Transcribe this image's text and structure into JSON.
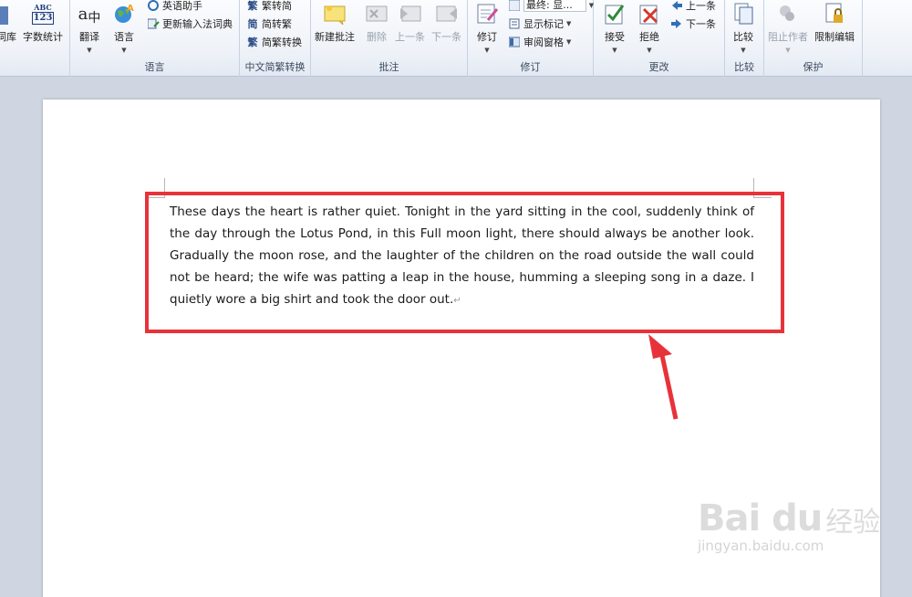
{
  "ribbon": {
    "groups": {
      "proofing_partial": {
        "label": ""
      },
      "language": {
        "label": "语言",
        "translate": "翻译",
        "language": "语言",
        "english_assistant": "英语助手",
        "update_ime_dict": "更新输入法词典"
      },
      "chinese_conversion": {
        "label": "中文简繁转换",
        "trad_to_simp": "繁转简",
        "simp_to_trad": "简转繁",
        "conversion": "简繁转换"
      },
      "comments": {
        "label": "批注",
        "new_comment": "新建批注",
        "delete": "删除",
        "previous": "上一条",
        "next": "下一条"
      },
      "tracking": {
        "label": "修订",
        "track_changes": "修订",
        "display_for_review": "最终: 显...",
        "show_markup": "显示标记",
        "reviewing_pane": "审阅窗格"
      },
      "changes": {
        "label": "更改",
        "accept": "接受",
        "reject": "拒绝",
        "previous": "上一条",
        "next": "下一条"
      },
      "compare": {
        "label": "比较",
        "compare": "比较"
      },
      "protect": {
        "label": "保护",
        "block_authors": "阻止作者",
        "restrict_editing": "限制编辑"
      }
    },
    "proofing": {
      "thesaurus_partial": "词库",
      "word_count": "字数统计",
      "abc_badge": "ABC",
      "num_badge": "123"
    }
  },
  "document": {
    "paragraph": "These days the heart is rather quiet. Tonight in the yard sitting in the cool, suddenly think of the day through the Lotus Pond, in this Full moon light, there should always be another look. Gradually the moon rose, and the laughter of the children on the road outside the wall could not be heard; the wife was patting a leap in the house, humming a sleeping song in a daze. I quietly wore a big shirt and took the door out.",
    "paragraph_mark": "↵"
  },
  "watermark": {
    "logo": "Bai du",
    "cn": "经验",
    "url": "jingyan.baidu.com"
  },
  "colors": {
    "highlight": "#e8323a",
    "arrow": "#e8323a"
  }
}
